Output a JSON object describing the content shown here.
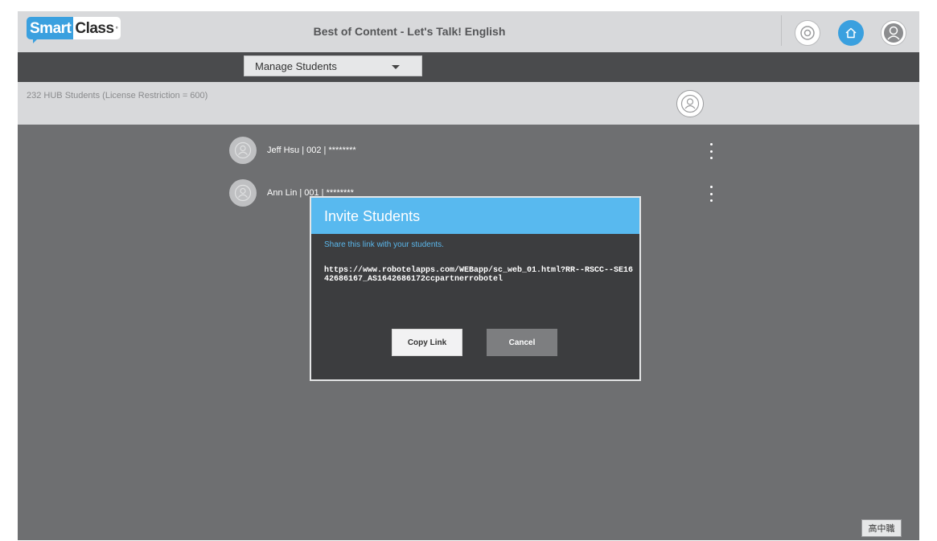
{
  "header": {
    "logo_smart": "Smart",
    "logo_class": "Class",
    "logo_tm": "°",
    "title": "Best of Content - Let's Talk! English",
    "settings_icon": "settings-circle-icon",
    "home_icon": "home-icon",
    "user_icon": "user-profile-icon"
  },
  "toolbar": {
    "dropdown_value": "Manage Students"
  },
  "infobar": {
    "summary": "232 HUB Students (License Restriction = 600)",
    "add_icon": "add-student-icon"
  },
  "students": [
    {
      "label": "Jeff Hsu | 002 | ********"
    },
    {
      "label": "Ann Lin | 001 | ********"
    }
  ],
  "modal": {
    "title": "Invite Students",
    "hint": "Share this link with your students.",
    "link": "https://www.robotelapps.com/WEBapp/sc_web_01.html?RR--RSCC--SE1642686167_AS1642686172ccpartnerrobotel",
    "copy_label": "Copy Link",
    "cancel_label": "Cancel"
  },
  "footer": {
    "language_label": "高中職"
  },
  "colors": {
    "accent": "#3aa0df",
    "modal_header": "#58b9ef",
    "background": "#6e6f71"
  }
}
